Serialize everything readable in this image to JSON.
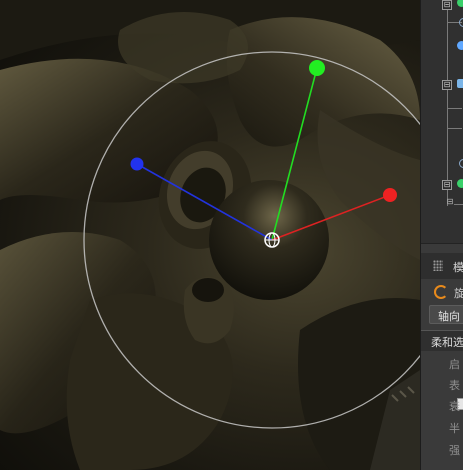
{
  "side_panel": {
    "header": {
      "title": "模"
    },
    "rotate_label": "旋",
    "axis_tab_label": "轴向",
    "soft_selection_header": "柔和选",
    "attributes": [
      "启",
      "表",
      "衰",
      "半",
      "强"
    ]
  },
  "colors": {
    "x_axis": "#dd2222",
    "y_axis": "#22dd22",
    "z_axis": "#2233dd",
    "gizmo_ring": "#c8c8c8",
    "accent_orange": "#e88a1c"
  },
  "icons": {
    "panel_grip": "grip-icon",
    "rotate_tool": "rotate-icon",
    "gizmo_center": "gizmo-center-icon"
  }
}
